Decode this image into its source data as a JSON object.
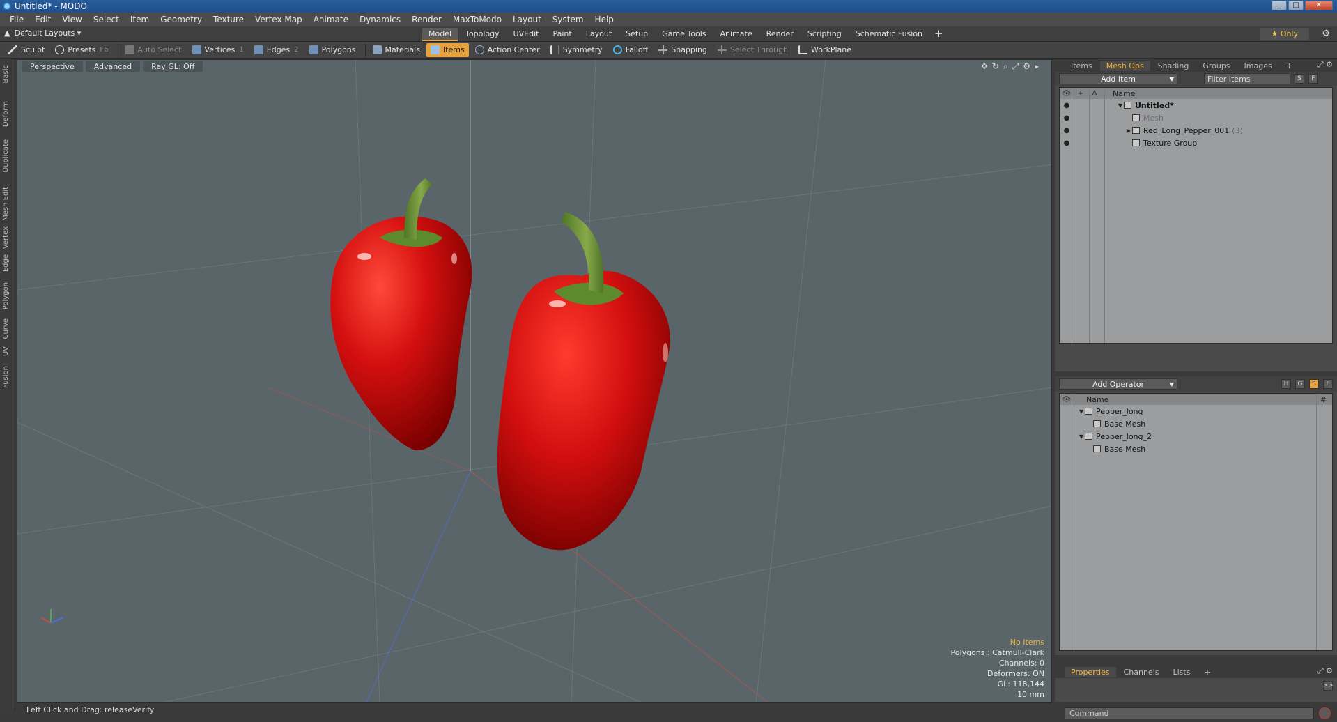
{
  "window": {
    "title": "Untitled* - MODO",
    "min": "_",
    "max": "□",
    "close": "✕"
  },
  "menu": [
    "File",
    "Edit",
    "View",
    "Select",
    "Item",
    "Geometry",
    "Texture",
    "Vertex Map",
    "Animate",
    "Dynamics",
    "Render",
    "MaxToModo",
    "Layout",
    "System",
    "Help"
  ],
  "layouts": {
    "label": "Default Layouts ▾",
    "tabs": [
      "Model",
      "Topology",
      "UVEdit",
      "Paint",
      "Layout",
      "Setup",
      "Game Tools",
      "Animate",
      "Render",
      "Scripting",
      "Schematic Fusion"
    ],
    "active": "Model",
    "plus": "+",
    "only": "★ Only"
  },
  "toolbar": {
    "sculpt": "Sculpt",
    "presets": "Presets",
    "presets_key": "F6",
    "auto_select": "Auto Select",
    "vertices": "Vertices",
    "vertices_num": "1",
    "edges": "Edges",
    "edges_num": "2",
    "polygons": "Polygons",
    "materials": "Materials",
    "items": "Items",
    "action_center": "Action Center",
    "symmetry": "Symmetry",
    "falloff": "Falloff",
    "snapping": "Snapping",
    "select_through": "Select Through",
    "workplane": "WorkPlane"
  },
  "left_tabs": [
    "Basic",
    "Deform",
    "Duplicate",
    "Mesh Edit",
    "Vertex",
    "Edge",
    "Polygon",
    "Curve",
    "UV",
    "Fusion"
  ],
  "viewport": {
    "view": "Perspective",
    "mode": "Advanced",
    "raygl": "Ray GL: Off",
    "info": {
      "no_items": "No Items",
      "polygons": "Polygons : Catmull-Clark",
      "channels": "Channels: 0",
      "deformers": "Deformers: ON",
      "gl": "GL: 118,144",
      "scale": "10 mm"
    }
  },
  "status": "Left Click and Drag:  releaseVerify",
  "items_panel": {
    "tabs": [
      "Items",
      "Mesh Ops",
      "Shading",
      "Groups",
      "Images"
    ],
    "active": "Mesh Ops",
    "plus": "+",
    "add_item": "Add Item",
    "filter": "Filter Items",
    "s": "S",
    "f": "F",
    "name_header": "Name",
    "rows": [
      {
        "label": "Untitled*",
        "count": ""
      },
      {
        "label": "Mesh",
        "count": ""
      },
      {
        "label": "Red_Long_Pepper_001",
        "count": "(3)"
      },
      {
        "label": "Texture Group",
        "count": ""
      }
    ]
  },
  "meshops_panel": {
    "add_operator": "Add Operator",
    "h": "H",
    "g": "G",
    "s": "S",
    "f": "F",
    "name_header": "Name",
    "hash": "#",
    "rows": [
      {
        "label": "Pepper_long"
      },
      {
        "label": "Base Mesh"
      },
      {
        "label": "Pepper_long_2"
      },
      {
        "label": "Base Mesh"
      }
    ]
  },
  "props_panel": {
    "tabs": [
      "Properties",
      "Channels",
      "Lists"
    ],
    "active": "Properties",
    "plus": "+",
    "expand": ">>"
  },
  "command": {
    "placeholder": "Command"
  },
  "colors": {
    "accent": "#e8a23b",
    "viewport_bg": "#5a6569",
    "pepper_red": "#d40f0f",
    "stem_green": "#5e8a2e"
  }
}
